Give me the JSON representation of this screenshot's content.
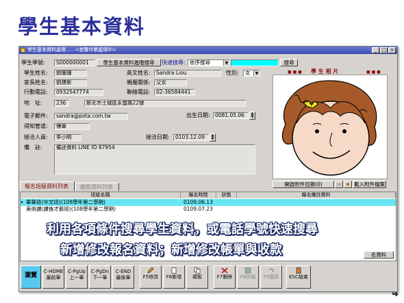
{
  "slide": {
    "title": "學生基本資料",
    "page_number": "4"
  },
  "window": {
    "title": "學生基本資料處理......<查覽作業處理中>"
  },
  "top": {
    "student_id_label": "學生學號:",
    "student_id": "S000000001",
    "sync_button": "學生基本資料進階搜尋",
    "quick_search_label": "快速搜尋:",
    "quick_search_select": "依序搜尋",
    "search_button": "搜尋"
  },
  "form": {
    "name_label": "學生姓名:",
    "name": "劉珊珊",
    "en_name_label": "英文姓名:",
    "en_name": "Sandra Liou",
    "gender_label": "性別:",
    "gender": "女",
    "parent_label": "家長姓名:",
    "parent": "劉建新",
    "relation_label": "親屬關係:",
    "relation": "父女",
    "mobile_label": "行動電話:",
    "mobile": "0932547774",
    "phone_label": "聯絡電話:",
    "phone": "02-36584441",
    "address_label": "地　址:",
    "zip": "236",
    "address": "新北市土城區永豐路22號",
    "email_label": "電子郵件:",
    "email": "sandra@pota.com.tw",
    "birthday_label": "出生日期:",
    "birthday": "0081.05.06",
    "source_label": "得知管道:",
    "source": "傳單",
    "staff_label": "接洽人員:",
    "staff": "李小明",
    "contact_date_label": "接洽日期:",
    "contact_date": "0103.12.09",
    "note_label": "備　註:",
    "note": "備註資料 LINE ID 87954"
  },
  "photo": {
    "label": "學 生 相 片"
  },
  "attach": {
    "catalog_button": "開啟附件目錄(0)",
    "import_button": "載入附件檔案"
  },
  "tabs": {
    "active": "報名班級資料列表",
    "inactive": "繳款資料列表"
  },
  "grid": {
    "headers": [
      "班級名稱",
      "報名時間",
      "狀態",
      "報名備註資料"
    ],
    "rows": [
      {
        "name": "華華班(中文班)(108學年第二學期)",
        "time": "0109.06.13"
      },
      {
        "name": "美術課(課後才藝班)(108學年第二學期)",
        "time": "0109.07.23"
      }
    ],
    "edit_button": "名資料"
  },
  "overlay": {
    "line1": "利用各項條件搜尋學生資料，或電話學號快速搜尋",
    "line2": "新增修改報名資料；新增修改帳單與收款"
  },
  "toolbar": [
    {
      "top": "",
      "label": "瀏覽"
    },
    {
      "top": "C-HOME",
      "label": "最前筆"
    },
    {
      "top": "C-PgUp",
      "label": "上一筆"
    },
    {
      "top": "C-PgDn",
      "label": "下一筆"
    },
    {
      "top": "C-END",
      "label": "最後筆"
    },
    {
      "top": "",
      "label": "F5修改"
    },
    {
      "top": "",
      "label": "F6新增"
    },
    {
      "top": "",
      "label": "複製"
    },
    {
      "top": "",
      "label": "F7刪除"
    },
    {
      "top": "",
      "label": "F8存檔"
    },
    {
      "top": "",
      "label": "F9還原"
    },
    {
      "top": "",
      "label": "ESC結束"
    }
  ],
  "colors": {
    "title": "#2a2f9a",
    "overlay_outline": "#1e2c64",
    "selected_row": "#66e6f2",
    "quick_search": "#00ffff"
  }
}
